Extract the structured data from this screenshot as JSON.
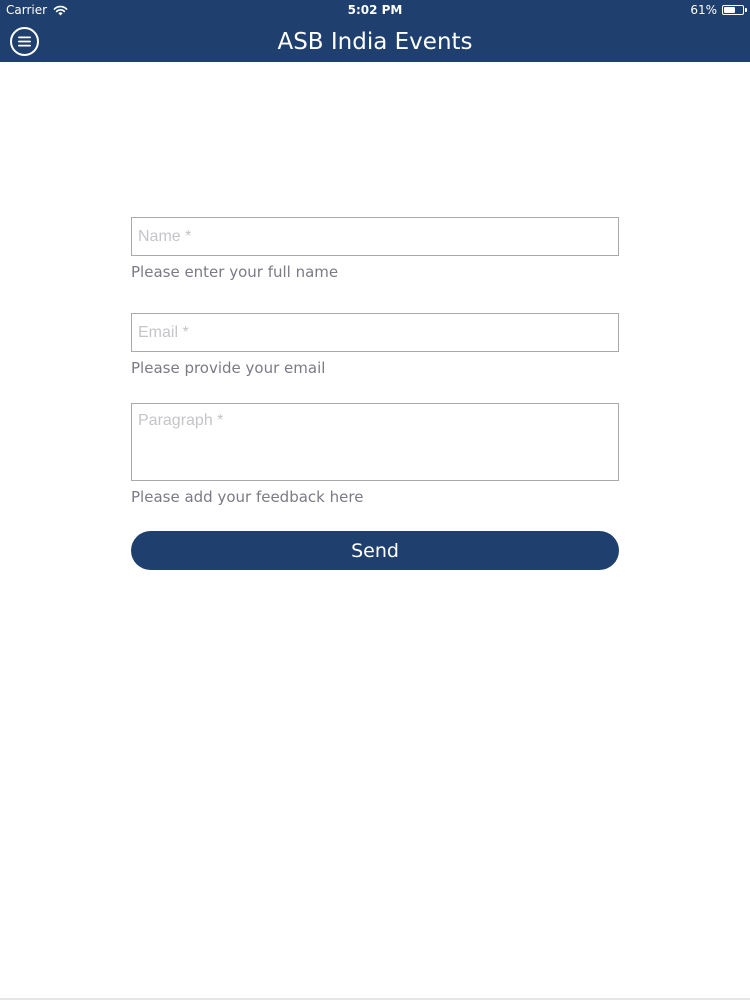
{
  "status_bar": {
    "carrier": "Carrier",
    "time": "5:02 PM",
    "battery_percent": "61%",
    "battery_level": 0.61,
    "wifi_icon": "wifi-icon",
    "battery_icon": "battery-icon"
  },
  "header": {
    "title": "ASB India Events",
    "menu_icon": "hamburger-menu-icon",
    "background_color": "#1f3f6e"
  },
  "form": {
    "name": {
      "value": "",
      "placeholder": "Name *",
      "hint": "Please enter your full name"
    },
    "email": {
      "value": "",
      "placeholder": "Email *",
      "hint": "Please provide your email"
    },
    "paragraph": {
      "value": "",
      "placeholder": "Paragraph *",
      "hint": "Please add your feedback here"
    },
    "send_label": "Send"
  },
  "colors": {
    "accent": "#1f3f6e",
    "hint_text": "#7b7b86",
    "placeholder": "#c5c5c9",
    "field_border": "#a9a9ae"
  }
}
